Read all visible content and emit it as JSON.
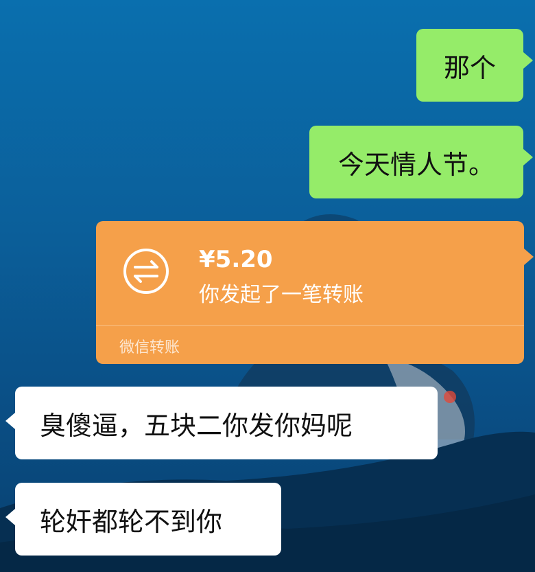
{
  "messages": [
    {
      "id": "m1",
      "direction": "sent",
      "text": "那个"
    },
    {
      "id": "m2",
      "direction": "sent",
      "text": "今天情人节。"
    },
    {
      "id": "m4",
      "direction": "received",
      "text": "臭傻逼，五块二你发你妈呢"
    },
    {
      "id": "m5",
      "direction": "received",
      "text": "轮奸都轮不到你"
    }
  ],
  "transfer": {
    "amount": "¥5.20",
    "description": "你发起了一笔转账",
    "footer": "微信转账",
    "icon": "transfer-arrows-icon"
  },
  "colors": {
    "sent_bubble": "#95ec69",
    "received_bubble": "#ffffff",
    "transfer_card": "#f5a04a",
    "background": "#0b5f9a"
  }
}
